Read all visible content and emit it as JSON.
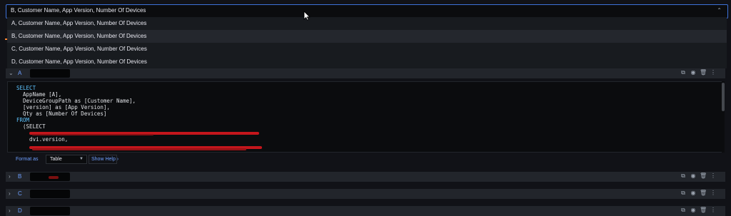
{
  "query_select": {
    "value": "B, Customer Name, App Version, Number Of Devices",
    "options": [
      "A, Customer Name, App Version, Number Of Devices",
      "B, Customer Name, App Version, Number Of Devices",
      "C, Customer Name, App Version, Number Of Devices",
      "D, Customer Name, App Version, Number Of Devices"
    ],
    "selected_index": 1
  },
  "queries": [
    {
      "ref": "A",
      "caret": "⌄"
    },
    {
      "ref": "B",
      "caret": "›"
    },
    {
      "ref": "C",
      "caret": "›"
    },
    {
      "ref": "D",
      "caret": "›"
    }
  ],
  "editor": {
    "lines": [
      {
        "kw": "SELECT",
        "text": ""
      },
      {
        "kw": "",
        "text": "  AppName [A],"
      },
      {
        "kw": "",
        "text": "  DeviceGroupPath as [Customer Name],"
      },
      {
        "kw": "",
        "text": "  [version] as [App Version],"
      },
      {
        "kw": "",
        "text": "  Qty as [Number Of Devices]"
      },
      {
        "kw": "FROM",
        "text": ""
      },
      {
        "kw": "",
        "text": "  (SELECT"
      },
      {
        "kw": "",
        "text": ""
      },
      {
        "kw": "",
        "text": "    dvi.version,"
      },
      {
        "kw": "",
        "text": ""
      },
      {
        "kw": "",
        "text": ""
      }
    ]
  },
  "options_bar": {
    "format_label": "Format as",
    "format_value": "Table",
    "show_help": "Show Help ›"
  },
  "colors": {
    "accent": "#3d71d9",
    "keyword": "#5ec4ff",
    "link": "#6e9fff",
    "redaction": "#c4161c"
  },
  "icons": [
    "duplicate-icon",
    "eye-icon",
    "trash-icon",
    "drag-handle-icon"
  ]
}
